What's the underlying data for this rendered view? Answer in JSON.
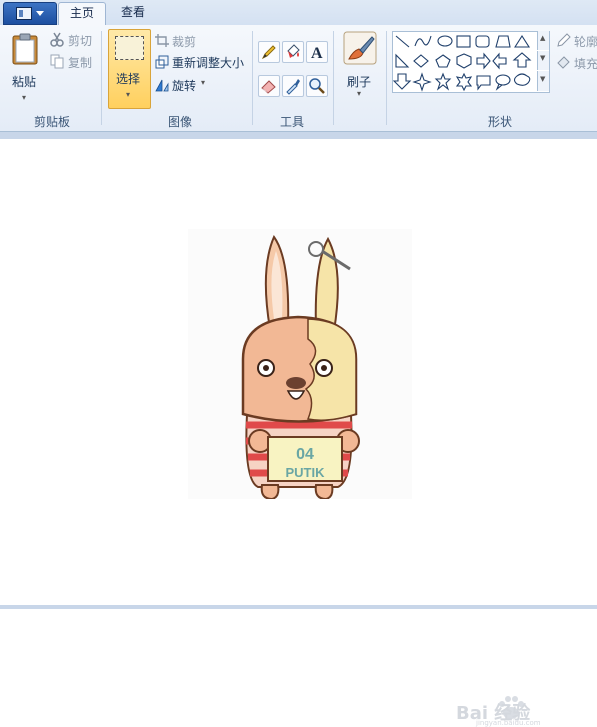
{
  "tabs": {
    "home": "主页",
    "view": "查看"
  },
  "clipboard": {
    "paste": "粘贴",
    "cut": "剪切",
    "copy": "复制",
    "group": "剪贴板"
  },
  "image": {
    "select": "选择",
    "crop": "裁剪",
    "resize": "重新调整大小",
    "rotate": "旋转",
    "group": "图像"
  },
  "tools": {
    "group": "工具"
  },
  "brushes": {
    "label": "刷子"
  },
  "shapes": {
    "group": "形状",
    "outline": "轮廓",
    "fill": "填充"
  },
  "canvas": {
    "card_line1": "04",
    "card_line2": "PUTIK"
  },
  "watermark": {
    "text": "Bai 经验",
    "sub": "jingyan.baidu.com"
  }
}
